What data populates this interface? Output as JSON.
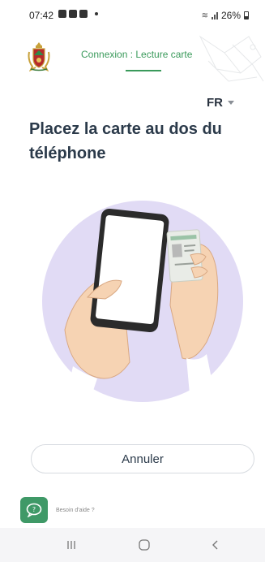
{
  "status_bar": {
    "time": "07:42",
    "battery": "26%"
  },
  "header": {
    "title": "Connexion : Lecture carte",
    "accent_color": "#3a9a5b"
  },
  "language": {
    "selected": "FR"
  },
  "main": {
    "title": "Placez la carte au dos du téléphone"
  },
  "actions": {
    "cancel_label": "Annuler"
  },
  "help": {
    "label": "Besoin d'aide ?",
    "icon": "chat-help-icon"
  },
  "nav": {
    "items": [
      "recent-apps-icon",
      "home-icon",
      "back-icon"
    ]
  }
}
